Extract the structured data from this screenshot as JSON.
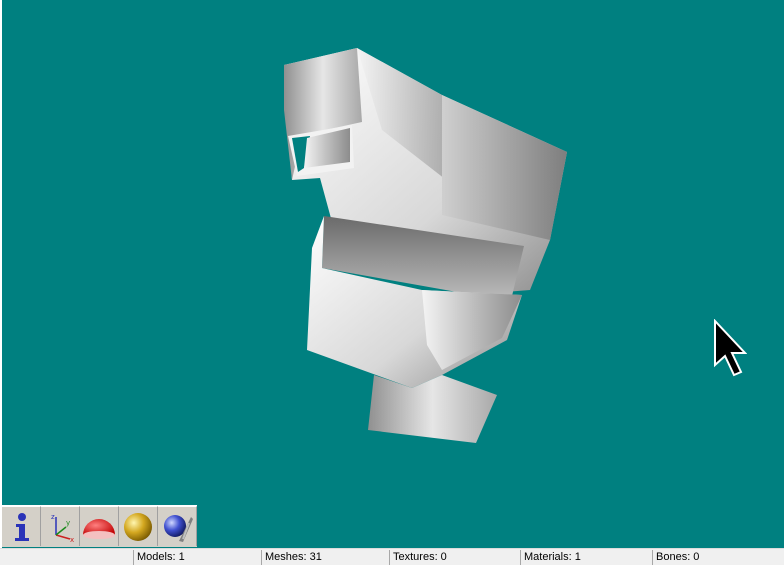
{
  "viewport": {
    "background": "#008080"
  },
  "toolbar": {
    "buttons": [
      {
        "name": "info-icon"
      },
      {
        "name": "axes-icon"
      },
      {
        "name": "hemisphere-icon"
      },
      {
        "name": "sphere-icon"
      },
      {
        "name": "sphere-wand-icon"
      }
    ]
  },
  "statusbar": {
    "models": "Models: 1",
    "meshes": "Meshes: 31",
    "textures": "Textures: 0",
    "materials": "Materials: 1",
    "bones": "Bones: 0"
  }
}
